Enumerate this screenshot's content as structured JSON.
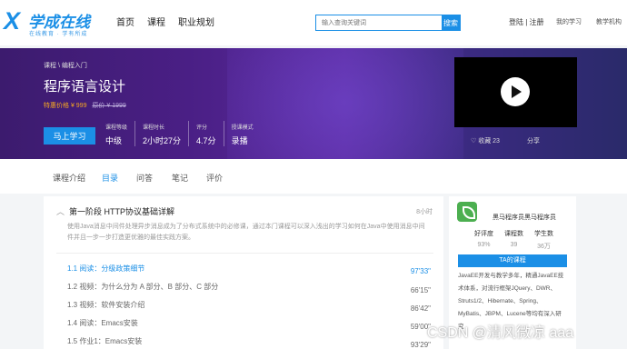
{
  "header": {
    "logo": {
      "mark": "X",
      "name": "学成在线",
      "slogan": "在线教育 · 学有所成"
    },
    "nav": [
      "首页",
      "课程",
      "职业规划"
    ],
    "search": {
      "placeholder": "输入查询关键词",
      "button": "搜索"
    },
    "user_links": "登陆 | 注册",
    "my_study": "我的学习",
    "teacher_center": "教学机构"
  },
  "banner": {
    "breadcrumb": "课程 \\ 编程入门",
    "title": "程序语言设计",
    "price_label": "特惠价格 ¥ 999",
    "original_price": "原价 ¥ 1999",
    "buy_label": "马上学习",
    "stats": [
      {
        "label": "课程等级",
        "value": "中级"
      },
      {
        "label": "课程时长",
        "value": "2小时27分"
      },
      {
        "label": "评分",
        "value": "4.7分"
      },
      {
        "label": "授课模式",
        "value": "录播"
      }
    ],
    "favorite": "♡ 收藏 23",
    "share": "分享"
  },
  "tabs": [
    "课程介绍",
    "目录",
    "问答",
    "笔记",
    "评价"
  ],
  "active_tab": "目录",
  "chapter": {
    "title": "第一阶段 HTTP协议基础详解",
    "duration": "8小时",
    "description": "使用Java消息中间件处理异步消息成为了分布式系统中的必修课，通过本门课程可以深入浅出的学习如何在Java中使用消息中间件并且一步一步打造更优雅的最佳实践方案。"
  },
  "lessons": [
    {
      "title": "1.1 阅读：分级政策细节",
      "time": "97'33\"",
      "active": true
    },
    {
      "title": "1.2 视频：为什么分为 A 部分、B 部分、C 部分",
      "time": "66'15\"",
      "active": false
    },
    {
      "title": "1.3 视频：软件安装介绍",
      "time": "86'42\"",
      "active": false
    },
    {
      "title": "1.4 阅读：Emacs安装",
      "time": "59'00\"",
      "active": false
    },
    {
      "title": "1.5 作业1：Emacs安装",
      "time": "93'29\"",
      "active": false
    }
  ],
  "teacher": {
    "name": "黑马程序员黑马程序员",
    "stats": [
      {
        "label": "好评度",
        "value": "93%"
      },
      {
        "label": "课程数",
        "value": "39"
      },
      {
        "label": "学生数",
        "value": "36万"
      }
    ],
    "course_button": "TA的课程",
    "bio": "JavaEE开发与教学多年，精通JavaEE技术体系，对流行框架JQuery、DWR、Struts1/2、Hibernate、Spring、MyBatis、JBPM、Lucene等均有深入研究"
  },
  "watermark": "CSDN @清风微凉 aaa",
  "colors": {
    "accent": "#1b8fe6",
    "price": "#f5a623",
    "banner": "#4a1f85"
  }
}
